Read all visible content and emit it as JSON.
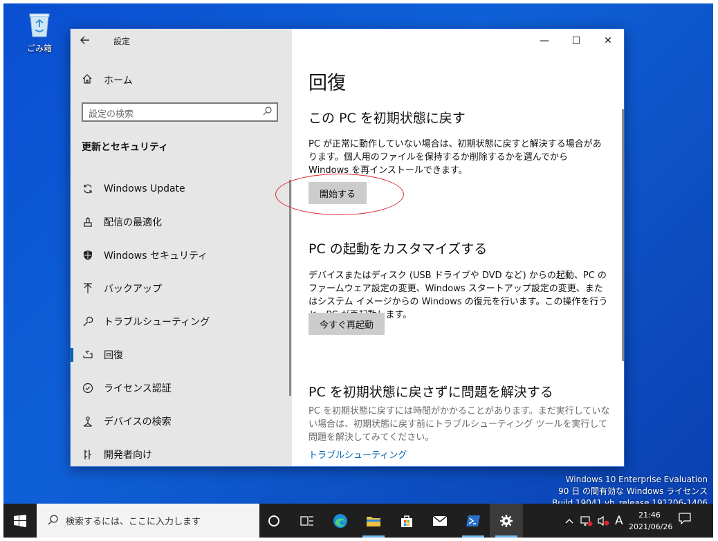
{
  "desktop": {
    "icon_label": "ごみ箱",
    "watermark": [
      "Windows 10 Enterprise Evaluation",
      "90 日 の間有効な Windows ライセンス",
      "Build 19041.vb_release.191206-1406"
    ]
  },
  "window": {
    "title": "設定",
    "controls": {
      "minimize": "—",
      "maximize": "☐",
      "close": "✕"
    }
  },
  "sidebar": {
    "home_label": "ホーム",
    "search_placeholder": "設定の検索",
    "section_title": "更新とセキュリティ",
    "items": [
      {
        "label": "Windows Update",
        "icon": "sync-icon"
      },
      {
        "label": "配信の最適化",
        "icon": "delivery-optimization-icon"
      },
      {
        "label": "Windows セキュリティ",
        "icon": "shield-icon"
      },
      {
        "label": "バックアップ",
        "icon": "backup-arrow-icon"
      },
      {
        "label": "トラブルシューティング",
        "icon": "wrench-icon"
      },
      {
        "label": "回復",
        "icon": "recovery-icon",
        "active": true
      },
      {
        "label": "ライセンス認証",
        "icon": "check-circle-icon"
      },
      {
        "label": "デバイスの検索",
        "icon": "find-device-icon"
      },
      {
        "label": "開発者向け",
        "icon": "developer-icon"
      }
    ]
  },
  "content": {
    "page_title": "回復",
    "reset": {
      "heading": "この PC を初期状態に戻す",
      "description": "PC が正常に動作していない場合は、初期状態に戻すと解決する場合があります。個人用のファイルを保持するか削除するかを選んでから Windows を再インストールできます。",
      "button": "開始する"
    },
    "advanced": {
      "heading": "PC の起動をカスタマイズする",
      "description": "デバイスまたはディスク (USB ドライブや DVD など) からの起動、PC のファームウェア設定の変更、Windows スタートアップ設定の変更、またはシステム イメージからの Windows の復元を行います。この操作を行うと、PC が再起動します。",
      "button": "今すぐ再起動"
    },
    "fix": {
      "heading": "PC を初期状態に戻さずに問題を解決する",
      "description": "PC を初期状態に戻すには時間がかかることがあります。まだ実行していない場合は、初期状態に戻す前にトラブルシューティング ツールを実行して問題を解決してみてください。",
      "link": "トラブルシューティング"
    }
  },
  "taskbar": {
    "search_placeholder": "検索するには、ここに入力します",
    "apps": [
      "cortana-icon",
      "task-view-icon",
      "edge-icon",
      "file-explorer-icon",
      "store-icon",
      "mail-icon",
      "powershell-icon",
      "settings-icon"
    ],
    "tray": {
      "ime": "A"
    },
    "clock": {
      "time": "21:46",
      "date": "2021/06/26"
    }
  },
  "colors": {
    "accent": "#0063b1",
    "desktop": "#0f60d8",
    "annotation": "#d9262a"
  }
}
